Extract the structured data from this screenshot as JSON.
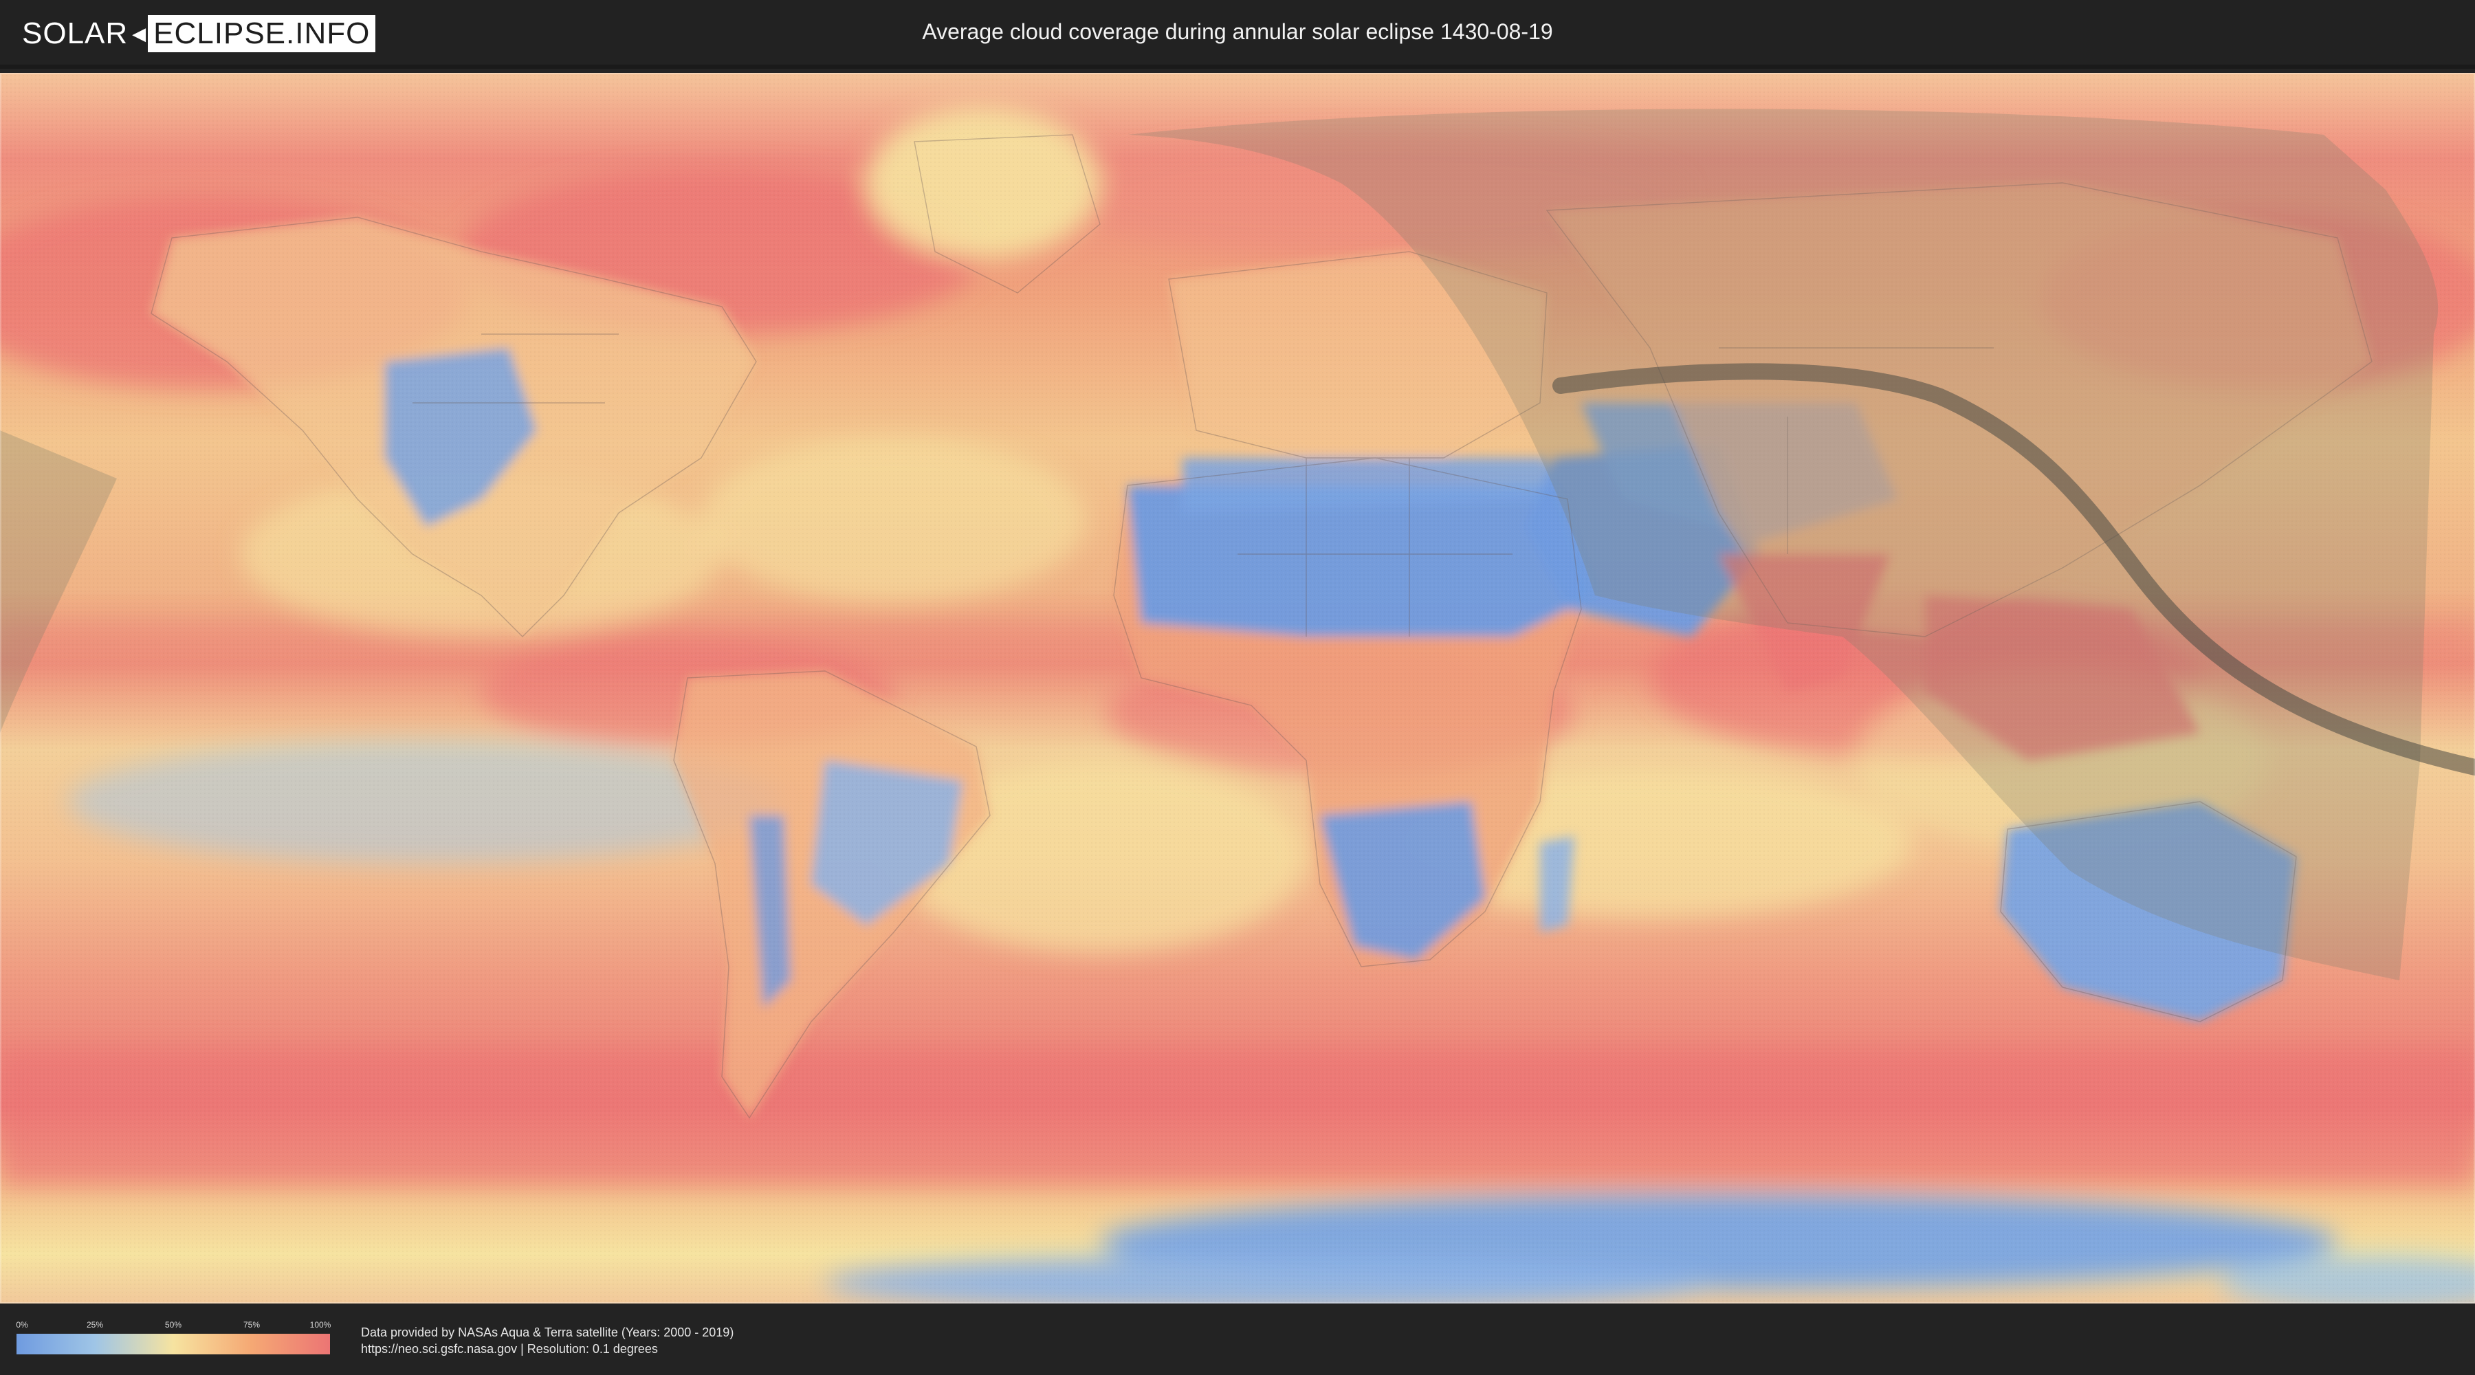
{
  "header": {
    "logo_solar": "SOLAR",
    "logo_eclipse": "ECLIPSE.INFO",
    "title": "Average cloud coverage during annular solar eclipse 1430-08-19"
  },
  "legend": {
    "ticks": [
      "0%",
      "25%",
      "50%",
      "75%",
      "100%"
    ],
    "colors": [
      "#6f9be0",
      "#9fc5e6",
      "#f6e3a0",
      "#f5a874",
      "#ec7574"
    ]
  },
  "credit": {
    "line1": "Data provided by NASAs Aqua & Terra satellite (Years: 2000 - 2019)",
    "line2": "https://neo.sci.gsfc.nasa.gov | Resolution: 0.1 degrees"
  },
  "map": {
    "projection": "equirectangular",
    "layers": [
      "cloud-coverage",
      "country-borders",
      "eclipse-visibility-zone",
      "annularity-path"
    ],
    "colors": {
      "clear": "#6f9be0",
      "partly": "#f6e3a0",
      "cloudy": "#ec7574",
      "eclipse_zone": "#8a8a6e",
      "central_path": "#4a4a44"
    }
  }
}
